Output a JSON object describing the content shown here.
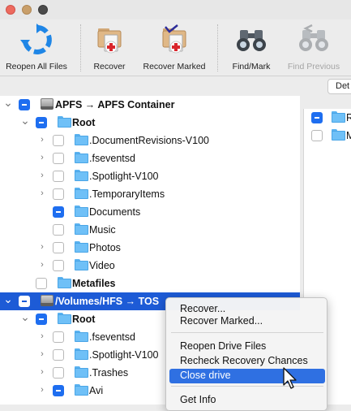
{
  "toolbar": {
    "buttons": [
      {
        "label": "Reopen All Files",
        "icon": "reopen-arrows-icon",
        "enabled": true
      },
      {
        "label": "Recover",
        "icon": "recover-icon",
        "enabled": true
      },
      {
        "label": "Recover Marked",
        "icon": "recover-marked-icon",
        "enabled": true
      },
      {
        "label": "Find/Mark",
        "icon": "binoculars-icon",
        "enabled": true
      },
      {
        "label": "Find Previous",
        "icon": "binoculars-back-icon",
        "enabled": false
      }
    ]
  },
  "view_button": {
    "label": "Det"
  },
  "tree": [
    {
      "name": "APFS → APFS Container",
      "bold": true,
      "check": "mixed",
      "expanded": true,
      "icon": "disk"
    },
    {
      "name": "Root",
      "bold": true,
      "check": "mixed",
      "expanded": true,
      "icon": "folder"
    },
    {
      "name": ".DocumentRevisions-V100",
      "bold": false,
      "check": "none",
      "expanded": false,
      "icon": "folder"
    },
    {
      "name": ".fseventsd",
      "bold": false,
      "check": "none",
      "expanded": false,
      "icon": "folder"
    },
    {
      "name": ".Spotlight-V100",
      "bold": false,
      "check": "none",
      "expanded": false,
      "icon": "folder"
    },
    {
      "name": ".TemporaryItems",
      "bold": false,
      "check": "none",
      "expanded": false,
      "icon": "folder"
    },
    {
      "name": "Documents",
      "bold": false,
      "check": "mixed",
      "expanded": false,
      "icon": "folder"
    },
    {
      "name": "Music",
      "bold": false,
      "check": "none",
      "expanded": false,
      "icon": "folder"
    },
    {
      "name": "Photos",
      "bold": false,
      "check": "none",
      "expanded": false,
      "icon": "folder"
    },
    {
      "name": "Video",
      "bold": false,
      "check": "none",
      "expanded": false,
      "icon": "folder"
    },
    {
      "name": "Metafiles",
      "bold": true,
      "check": "none",
      "expanded": false,
      "icon": "folder"
    },
    {
      "name": "/Volumes/HFS → TOS",
      "bold": true,
      "check": "mixed",
      "expanded": true,
      "icon": "disk",
      "selected": true
    },
    {
      "name": "Root",
      "bold": true,
      "check": "mixed",
      "expanded": true,
      "icon": "folder"
    },
    {
      "name": ".fseventsd",
      "bold": false,
      "check": "none",
      "expanded": false,
      "icon": "folder"
    },
    {
      "name": ".Spotlight-V100",
      "bold": false,
      "check": "none",
      "expanded": false,
      "icon": "folder"
    },
    {
      "name": ".Trashes",
      "bold": false,
      "check": "none",
      "expanded": false,
      "icon": "folder"
    },
    {
      "name": "Avi",
      "bold": false,
      "check": "mixed",
      "expanded": false,
      "icon": "folder"
    }
  ],
  "right_pane": [
    {
      "name": "R",
      "check": "mixed"
    },
    {
      "name": "M",
      "check": "none"
    }
  ],
  "context_menu": {
    "items": [
      {
        "label": "Recover...",
        "highlighted": false
      },
      {
        "label": "Recover Marked...",
        "highlighted": false
      },
      {
        "separator": true
      },
      {
        "label": "Reopen Drive Files",
        "highlighted": false
      },
      {
        "label": "Recheck Recovery Chances",
        "highlighted": false
      },
      {
        "label": "Close drive",
        "highlighted": true
      },
      {
        "separator": true
      },
      {
        "label": "Get Info",
        "highlighted": false
      }
    ]
  }
}
